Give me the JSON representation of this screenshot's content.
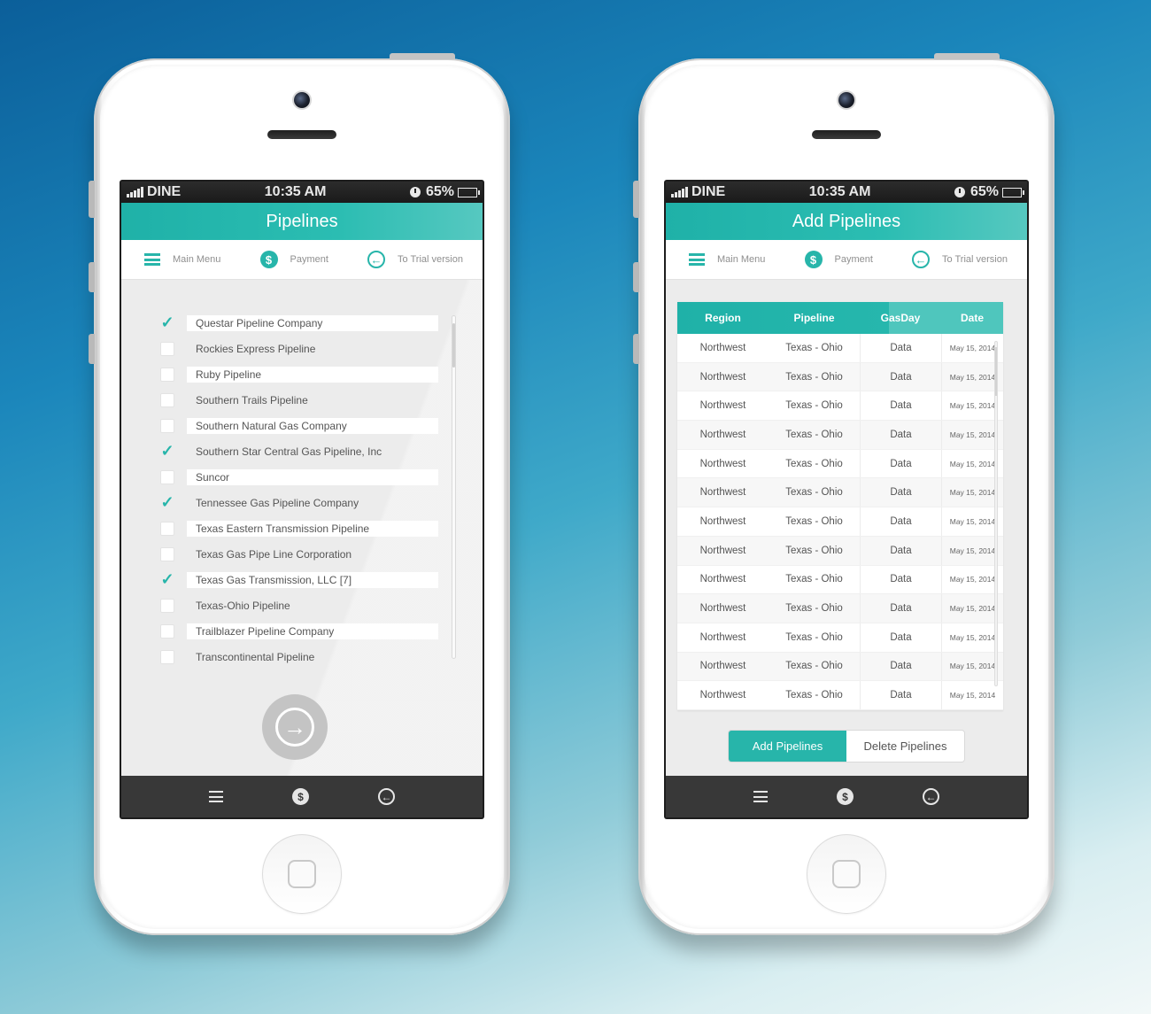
{
  "status_bar": {
    "carrier": "DINE",
    "time": "10:35 AM",
    "battery": "65%",
    "battery_level": 0.65
  },
  "nav": {
    "main_menu": "Main Menu",
    "payment": "Payment",
    "trial": "To Trial version"
  },
  "icons": {
    "menu": "menu-icon",
    "payment": "dollar-icon",
    "back": "arrow-left-icon",
    "next": "arrow-right-icon"
  },
  "colors": {
    "accent": "#27b5aa",
    "bottom_bar": "#383838"
  },
  "left_screen": {
    "title": "Pipelines",
    "items": [
      {
        "label": "Questar Pipeline Company",
        "checked": true
      },
      {
        "label": "Rockies Express Pipeline",
        "checked": false
      },
      {
        "label": "Ruby Pipeline",
        "checked": false
      },
      {
        "label": "Southern Trails Pipeline",
        "checked": false
      },
      {
        "label": "Southern Natural Gas Company",
        "checked": false
      },
      {
        "label": "Southern Star Central Gas Pipeline, Inc",
        "checked": true
      },
      {
        "label": "Suncor",
        "checked": false
      },
      {
        "label": "Tennessee Gas Pipeline Company",
        "checked": true
      },
      {
        "label": "Texas Eastern Transmission Pipeline",
        "checked": false
      },
      {
        "label": "Texas Gas Pipe Line Corporation",
        "checked": false
      },
      {
        "label": "Texas Gas Transmission, LLC [7]",
        "checked": true
      },
      {
        "label": "Texas-Ohio Pipeline",
        "checked": false
      },
      {
        "label": "Trailblazer Pipeline Company",
        "checked": false
      },
      {
        "label": "Transcontinental Pipeline",
        "checked": false
      }
    ]
  },
  "right_screen": {
    "title": "Add Pipelines",
    "columns": [
      "Region",
      "Pipeline",
      "GasDay",
      "Date"
    ],
    "rows": [
      [
        "Northwest",
        "Texas - Ohio",
        "Data",
        "May 15, 2014"
      ],
      [
        "Northwest",
        "Texas - Ohio",
        "Data",
        "May 15, 2014"
      ],
      [
        "Northwest",
        "Texas - Ohio",
        "Data",
        "May 15, 2014"
      ],
      [
        "Northwest",
        "Texas - Ohio",
        "Data",
        "May 15, 2014"
      ],
      [
        "Northwest",
        "Texas - Ohio",
        "Data",
        "May 15, 2014"
      ],
      [
        "Northwest",
        "Texas - Ohio",
        "Data",
        "May 15, 2014"
      ],
      [
        "Northwest",
        "Texas - Ohio",
        "Data",
        "May 15, 2014"
      ],
      [
        "Northwest",
        "Texas - Ohio",
        "Data",
        "May 15, 2014"
      ],
      [
        "Northwest",
        "Texas - Ohio",
        "Data",
        "May 15, 2014"
      ],
      [
        "Northwest",
        "Texas - Ohio",
        "Data",
        "May 15, 2014"
      ],
      [
        "Northwest",
        "Texas - Ohio",
        "Data",
        "May 15, 2014"
      ],
      [
        "Northwest",
        "Texas - Ohio",
        "Data",
        "May 15, 2014"
      ],
      [
        "Northwest",
        "Texas - Ohio",
        "Data",
        "May 15, 2014"
      ]
    ],
    "add_button": "Add Pipelines",
    "delete_button": "Delete Pipelines"
  }
}
